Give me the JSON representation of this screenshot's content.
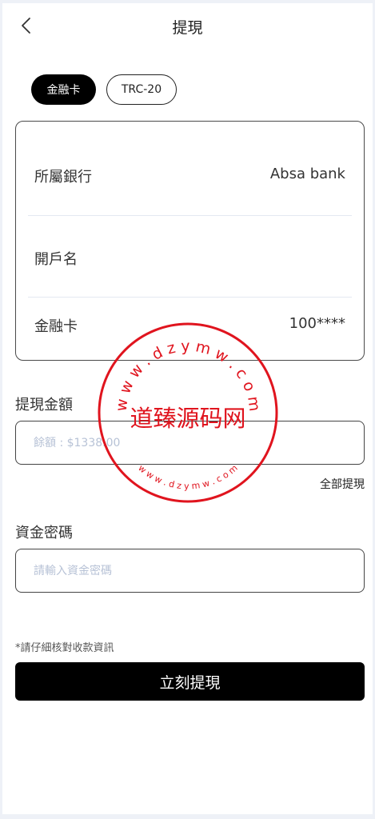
{
  "header": {
    "title": "提現",
    "back_icon": "chevron-left-icon"
  },
  "tabs": [
    {
      "label": "金融卡",
      "active": true
    },
    {
      "label": "TRC-20",
      "active": false
    }
  ],
  "card": {
    "bank_label": "所屬銀行",
    "bank_value": "Absa bank",
    "holder_label": "開戶名",
    "holder_value": "",
    "card_label": "金融卡",
    "card_value": "100****"
  },
  "amount": {
    "label": "提現金額",
    "placeholder": "餘額 : $1338.00",
    "value": "",
    "withdraw_all": "全部提現"
  },
  "password": {
    "label": "資金密碼",
    "placeholder": "請輸入資金密碼",
    "value": ""
  },
  "note": "*請仔細核對收款資訊",
  "submit_label": "立刻提現",
  "watermark": {
    "center_text": "道臻源码网",
    "top_arc": "w w w . d z y m w . c o m",
    "bottom_arc": "w w w . d z y m w . c o m",
    "color": "#e0141e"
  }
}
